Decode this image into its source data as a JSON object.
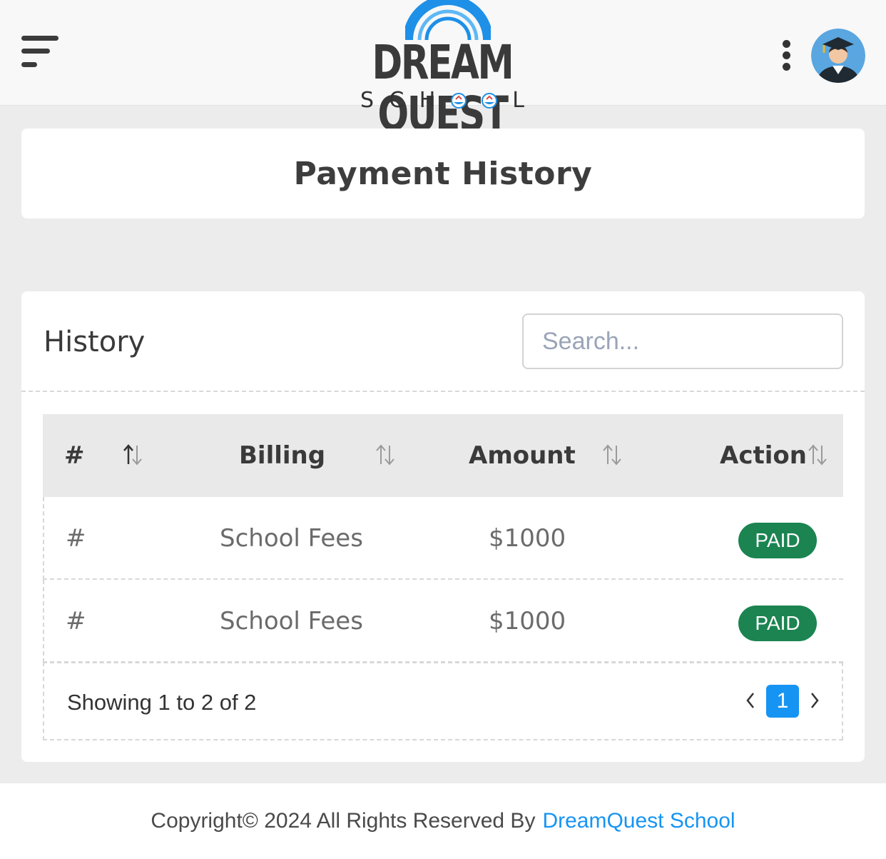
{
  "header": {
    "logo_brand": "DREAM QUEST",
    "logo_sub_letters": [
      "S",
      "C",
      "H",
      "",
      "",
      "L"
    ],
    "menu_icon": "hamburger-menu-icon",
    "more_icon": "kebab-menu-icon",
    "avatar_icon": "graduate-avatar"
  },
  "page": {
    "title": "Payment History"
  },
  "history": {
    "title": "History",
    "search_placeholder": "Search...",
    "search_value": "",
    "columns": [
      {
        "label": "#",
        "sort_icon": "sort-icon"
      },
      {
        "label": "Billing",
        "sort_icon": "sort-icon"
      },
      {
        "label": "Amount",
        "sort_icon": "sort-icon"
      },
      {
        "label": "Action",
        "sort_icon": "sort-icon"
      }
    ],
    "rows": [
      {
        "num": "#",
        "billing": "School Fees",
        "amount": "$1000",
        "status": "PAID"
      },
      {
        "num": "#",
        "billing": "School Fees",
        "amount": "$1000",
        "status": "PAID"
      }
    ],
    "showing_text": "Showing 1 to 2 of 2",
    "current_page": "1"
  },
  "footer": {
    "copyright": "Copyright© 2024 All Rights Reserved By",
    "link_text": "DreamQuest School"
  },
  "colors": {
    "accent": "#1694f3",
    "paid_badge": "#1b8451",
    "background": "#ececec"
  }
}
